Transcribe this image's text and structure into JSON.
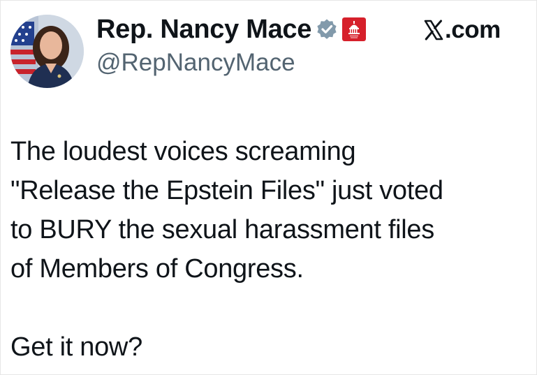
{
  "author": {
    "display_name": "Rep. Nancy Mace",
    "handle": "@RepNancyMace",
    "verified_icon": "verified-badge-icon",
    "affiliation_icon": "house-gop-capitol-icon"
  },
  "source": {
    "logo_icon": "x-logo-icon",
    "label": ".com"
  },
  "tweet": {
    "paragraph_1": [
      "The loudest voices screaming",
      "\"Release the Epstein Files\" just voted",
      "to BURY the sexual harassment files",
      "of Members of Congress."
    ],
    "paragraph_2": [
      "Get it now?"
    ]
  },
  "colors": {
    "text": "#0f1419",
    "handle": "#536471",
    "verified": "#829aab",
    "affiliation_red": "#d6202b"
  }
}
